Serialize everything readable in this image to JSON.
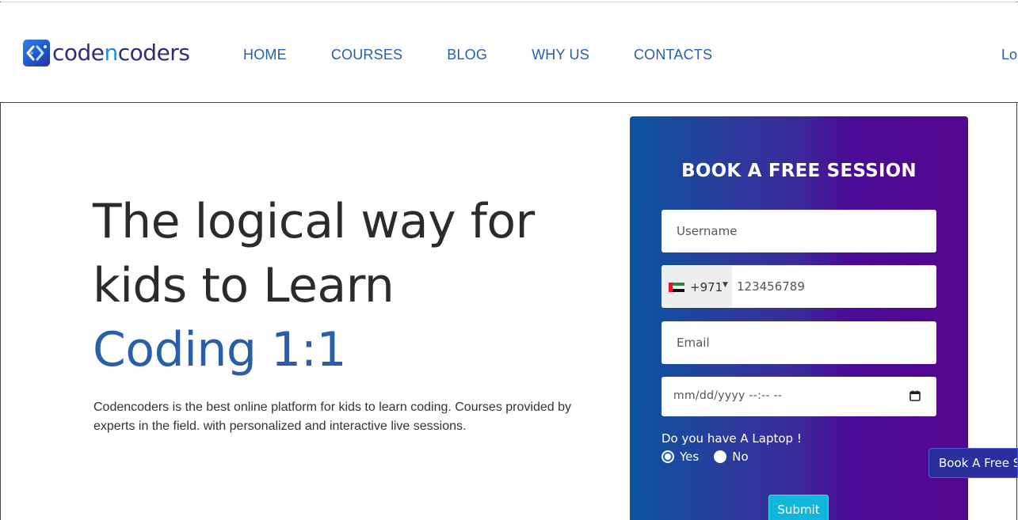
{
  "brand": {
    "logo_text_a": "code",
    "logo_text_b": "n",
    "logo_text_c": "coders",
    "logo_icon": "code-brackets-icon"
  },
  "nav": {
    "items": [
      "HOME",
      "COURSES",
      "BLOG",
      "WHY US",
      "CONTACTS"
    ],
    "login_label": "Lo"
  },
  "hero": {
    "title_line1": "The logical way for",
    "title_line2": "kids to Learn",
    "title_accent": "Coding 1:1",
    "description": "Codencoders is the best online platform for kids to learn coding. Courses provided by experts in the field. with personalized and interactive live sessions."
  },
  "form": {
    "title": "BOOK A FREE SESSION",
    "username_placeholder": "Username",
    "phone_country_code": "+971",
    "phone_value": "123456789",
    "email_placeholder": "Email",
    "datetime_placeholder": "mm/dd/yyyy --:-- --",
    "laptop_question": "Do you have A Laptop !",
    "options": [
      {
        "label": "Yes",
        "checked": true
      },
      {
        "label": "No",
        "checked": false
      }
    ],
    "submit_label": "Submit"
  },
  "floating": {
    "label": "Book A Free S"
  },
  "colors": {
    "accent": "#2a5ea8",
    "form_gradient_start": "#0a55a0",
    "form_gradient_end": "#55068f",
    "submit": "#11b6dc"
  }
}
